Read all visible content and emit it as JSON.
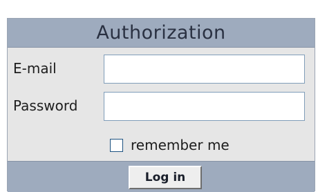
{
  "header": {
    "title": "Authorization"
  },
  "fields": {
    "email": {
      "label": "E-mail",
      "value": "",
      "placeholder": ""
    },
    "password": {
      "label": "Password",
      "value": "",
      "placeholder": ""
    }
  },
  "remember": {
    "label": "remember me",
    "checked": false
  },
  "actions": {
    "login_label": "Log in"
  },
  "colors": {
    "header_bg": "#9eabbe",
    "body_bg": "#e6e6e6",
    "input_border": "#7f9db9",
    "checkbox_border": "#1c5180"
  }
}
